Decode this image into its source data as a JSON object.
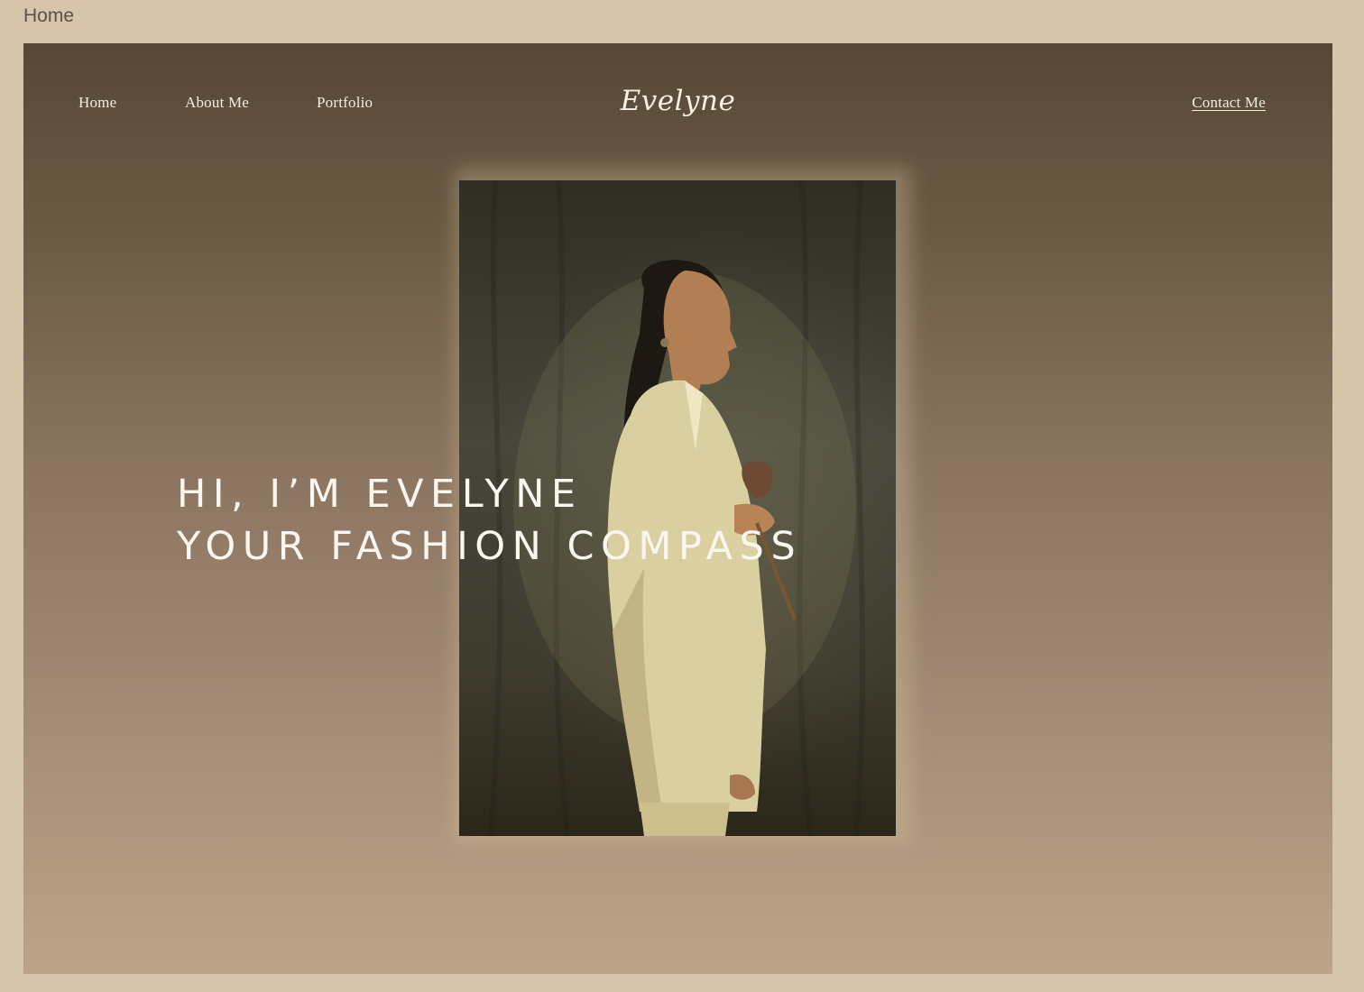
{
  "page": {
    "label": "Home"
  },
  "nav": {
    "home": "Home",
    "about": "About Me",
    "portfolio": "Portfolio",
    "contact": "Contact Me"
  },
  "brand": {
    "logo": "Evelyne"
  },
  "hero": {
    "line1": "HI, I’M EVELYNE",
    "line2": "YOUR FASHION COMPASS"
  },
  "colors": {
    "outer_background": "#d6c5aa",
    "gradient_top": "#574836",
    "gradient_bottom": "#bca488",
    "text": "#f4ede2"
  }
}
